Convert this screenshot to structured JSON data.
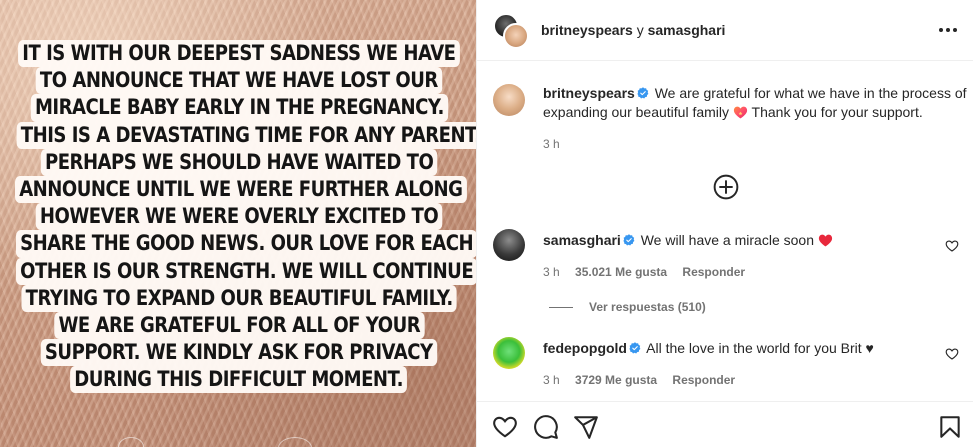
{
  "story": {
    "lines": [
      "IT IS WITH OUR DEEPEST SADNESS WE HAVE",
      "TO ANNOUNCE THAT WE HAVE LOST OUR",
      "MIRACLE BABY EARLY IN THE PREGNANCY.",
      "THIS IS A DEVASTATING TIME FOR ANY PARENT.",
      "PERHAPS WE SHOULD HAVE WAITED TO",
      "ANNOUNCE UNTIL WE WERE FURTHER ALONG",
      "HOWEVER WE WERE OVERLY EXCITED TO",
      "SHARE THE GOOD NEWS. OUR LOVE FOR EACH",
      "OTHER IS OUR STRENGTH. WE WILL CONTINUE",
      "TRYING TO EXPAND OUR BEAUTIFUL FAMILY.",
      "WE ARE GRATEFUL FOR ALL OF YOUR",
      "SUPPORT.  WE KINDLY ASK FOR PRIVACY",
      "DURING THIS DIFFICULT MOMENT."
    ]
  },
  "header": {
    "user1": "britneyspears",
    "conjunction": "y",
    "user2": "samasghari",
    "more_icon": "more-horizontal-icon"
  },
  "caption": {
    "username": "britneyspears",
    "text_before_emoji": "We are grateful for what we have in the process of expanding our beautiful family",
    "text_after_emoji": "Thank you for your support.",
    "emoji": "heart-emoji",
    "time": "3 h"
  },
  "comments": [
    {
      "username": "samasghari",
      "text": "We will have a miracle soon",
      "emoji": "red-heart",
      "time": "3 h",
      "likes": "35.021 Me gusta",
      "reply_label": "Responder",
      "view_replies": "Ver respuestas (510)"
    },
    {
      "username": "fedepopgold",
      "text": "All the love in the world for you Brit ♥",
      "time": "3 h",
      "likes": "3729 Me gusta",
      "reply_label": "Responder"
    }
  ],
  "colors": {
    "verified": "#3897f0",
    "text": "#262626",
    "muted": "#737373",
    "red_heart": "#ed4956"
  }
}
